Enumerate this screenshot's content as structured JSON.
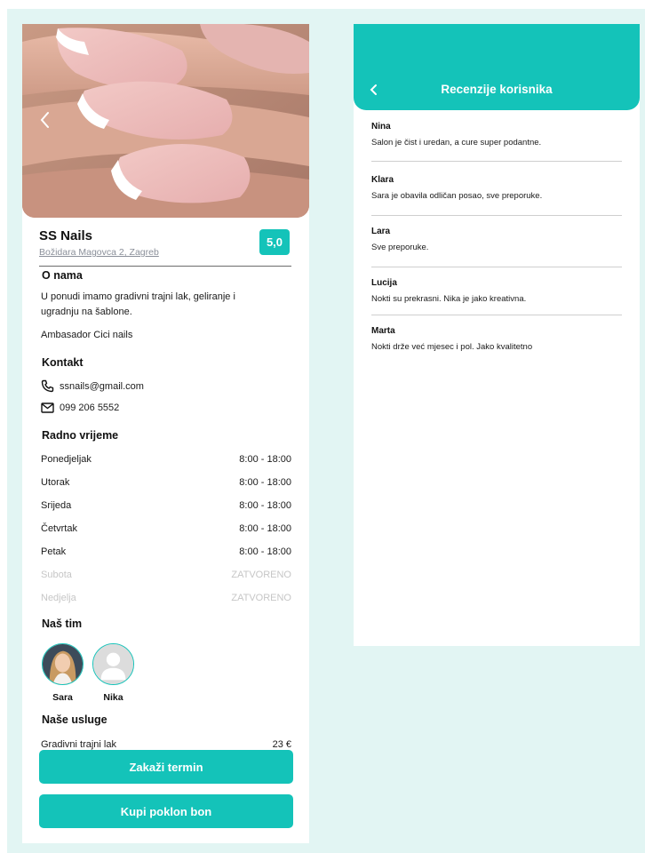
{
  "colors": {
    "accent": "#14c3b9",
    "background": "#e2f5f3",
    "closed_text": "#c6c6c6"
  },
  "salon": {
    "name": "SS Nails",
    "address": "Božidara Magovca 2, Zagreb",
    "rating": "5,0",
    "back_icon": "chevron-left-icon"
  },
  "about": {
    "title": "O nama",
    "line1": "U ponudi imamo gradivni trajni lak, geliranje i",
    "line2": "ugradnju na šablone.",
    "line3": "Ambasador Cici nails"
  },
  "contact": {
    "title": "Kontakt",
    "email": "ssnails@gmail.com",
    "email_icon": "phone-icon",
    "phone": "099 206 5552",
    "phone_icon": "envelope-icon"
  },
  "hours": {
    "title": "Radno vrijeme",
    "days": [
      {
        "day": "Ponedjeljak",
        "time": "8:00 - 18:00"
      },
      {
        "day": "Utorak",
        "time": "8:00 - 18:00"
      },
      {
        "day": "Srijeda",
        "time": "8:00 - 18:00"
      },
      {
        "day": "Četvrtak",
        "time": "8:00 - 18:00"
      },
      {
        "day": "Petak",
        "time": "8:00 - 18:00"
      },
      {
        "day": "Subota",
        "time": "ZATVORENO"
      },
      {
        "day": "Nedjelja",
        "time": "ZATVORENO"
      }
    ]
  },
  "team": {
    "title": "Naš tim",
    "members": [
      {
        "name": "Sara"
      },
      {
        "name": "Nika"
      }
    ]
  },
  "services": {
    "title": "Naše usluge",
    "items": [
      {
        "name": "Gradivni trajni lak",
        "price": "23 €"
      }
    ]
  },
  "buttons": {
    "book": "Zakaži termin",
    "gift": "Kupi poklon bon"
  },
  "reviews": {
    "title": "Recenzije korisnika",
    "back_icon": "chevron-left-icon",
    "items": [
      {
        "name": "Nina",
        "text": "Salon je čist i uredan, a cure super podantne."
      },
      {
        "name": "Klara",
        "text": "Sara je obavila odličan posao, sve preporuke."
      },
      {
        "name": "Lara",
        "text": "Sve preporuke."
      },
      {
        "name": "Lucija",
        "text": "Nokti su prekrasni. Nika je jako kreativna."
      },
      {
        "name": "Marta",
        "text": "Nokti drže već mjesec i pol. Jako kvalitetno"
      }
    ]
  }
}
